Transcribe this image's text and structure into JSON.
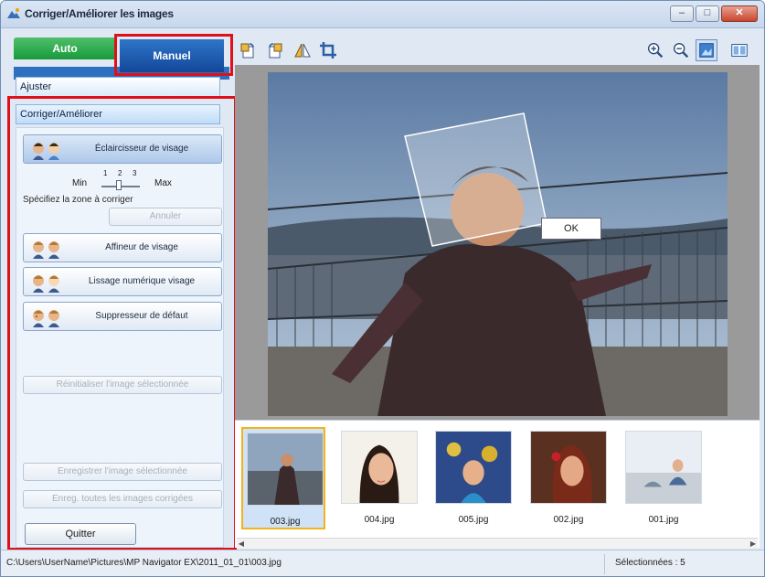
{
  "window": {
    "title": "Corriger/Améliorer les images",
    "controls": {
      "minimize": "–",
      "maximize": "□",
      "close": "✕"
    }
  },
  "tabs": {
    "auto": "Auto",
    "manual": "Manuel"
  },
  "sections": {
    "adjust": "Ajuster",
    "correct": "Corriger/Améliorer"
  },
  "tools": {
    "eclaircisseur": "Éclaircisseur de visage",
    "affineur": "Affineur de visage",
    "lissage": "Lissage numérique visage",
    "suppresseur": "Suppresseur de défaut"
  },
  "slider": {
    "min": "Min",
    "max": "Max",
    "ticks": [
      "1",
      "2",
      "3"
    ],
    "level": 2
  },
  "zone_text": "Spécifiez la zone à corriger",
  "buttons": {
    "annuler": "Annuler",
    "reinitialiser": "Réinitialiser l'image sélectionnée",
    "enregistrer": "Enregistrer l'image sélectionnée",
    "enregistrer_toutes": "Enreg. toutes les images corrigées",
    "quitter": "Quitter"
  },
  "toolbar": {
    "left_icons": [
      "rotate-left-icon",
      "rotate-right-icon",
      "flip-icon",
      "crop-icon"
    ],
    "right_icons": [
      "zoom-in-icon",
      "zoom-out-icon",
      "view-single-icon",
      "view-compare-icon"
    ]
  },
  "preview": {
    "ok_label": "OK"
  },
  "thumbnails": [
    {
      "label": "003.jpg",
      "selected": true
    },
    {
      "label": "004.jpg",
      "selected": false
    },
    {
      "label": "005.jpg",
      "selected": false
    },
    {
      "label": "002.jpg",
      "selected": false
    },
    {
      "label": "001.jpg",
      "selected": false
    }
  ],
  "status": {
    "path": "C:\\Users\\UserName\\Pictures\\MP Navigator EX\\2011_01_01\\003.jpg",
    "selected": "Sélectionnées : 5"
  },
  "colors": {
    "highlight": "#e0101a",
    "manual_tab": "#12489a",
    "auto_tab": "#189a3c"
  }
}
